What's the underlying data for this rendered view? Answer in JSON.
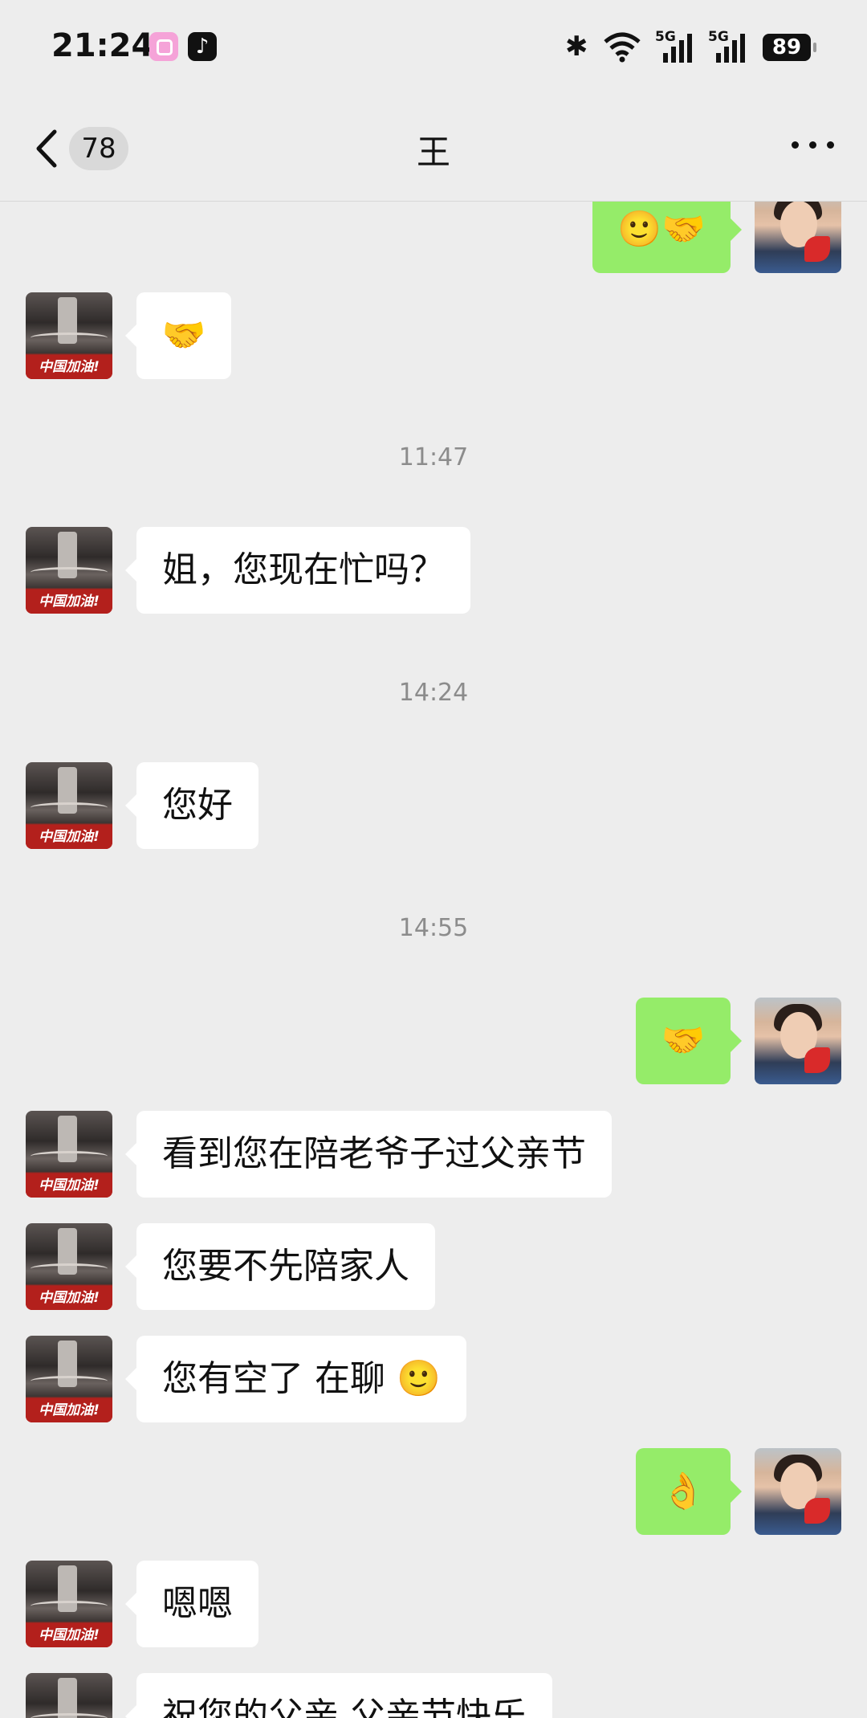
{
  "status_bar": {
    "time": "21:24",
    "apps": [
      "instagram-icon",
      "tiktok-icon"
    ],
    "bluetooth": "bluetooth-icon",
    "network_1": "5G",
    "network_2": "5G",
    "battery": "89"
  },
  "header": {
    "back_icon": "chevron-left-icon",
    "unread_count": "78",
    "title": "王",
    "more_icon": "more-icon"
  },
  "messages": [
    {
      "side": "right",
      "content": "🙂🤝"
    },
    {
      "side": "left",
      "content": "🤝"
    },
    {
      "type": "time",
      "content": "11:47"
    },
    {
      "side": "left",
      "content": "姐，您现在忙吗？"
    },
    {
      "type": "time",
      "content": "14:24"
    },
    {
      "side": "left",
      "content": "您好"
    },
    {
      "type": "time",
      "content": "14:55"
    },
    {
      "side": "right",
      "content": "🤝"
    },
    {
      "side": "left",
      "content": "看到您在陪老爷子过父亲节"
    },
    {
      "side": "left",
      "content": "您要不先陪家人"
    },
    {
      "side": "left",
      "content": "您有空了 在聊 🙂"
    },
    {
      "side": "right",
      "content": "👌"
    },
    {
      "side": "left",
      "content": "嗯嗯"
    },
    {
      "side": "left",
      "content": "祝您的父亲 父亲节快乐"
    }
  ],
  "left_avatar_caption": "中国加油!",
  "colors": {
    "background": "#ededed",
    "own_bubble": "#95ec69",
    "other_bubble": "#ffffff",
    "timestamp": "#8c8c8c"
  }
}
